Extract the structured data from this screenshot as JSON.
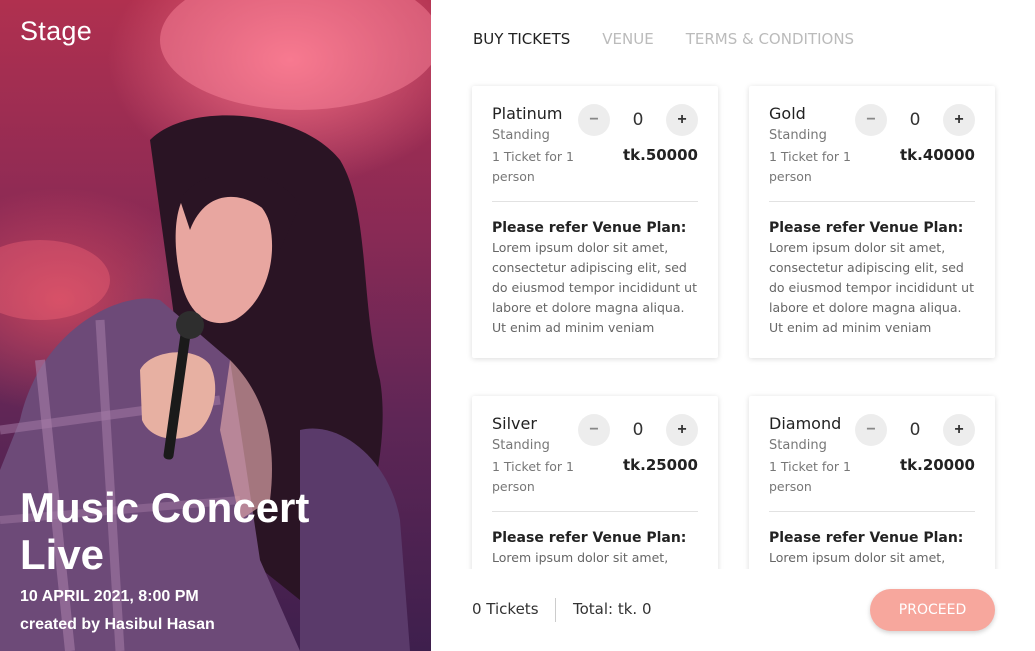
{
  "hero": {
    "brand": "Stage",
    "title": "Music Concert Live",
    "date": "10 APRIL 2021, 8:00 PM",
    "creator": "created by Hasibul Hasan"
  },
  "tabs": [
    {
      "label": "BUY TICKETS",
      "active": true
    },
    {
      "label": "VENUE",
      "active": false
    },
    {
      "label": "TERMS & CONDITIONS",
      "active": false
    }
  ],
  "tickets": [
    {
      "name": "Platinum",
      "type": "Standing",
      "desc": "1 Ticket for 1 person",
      "qty": "0",
      "price": "tk.50000",
      "minus": "−",
      "plus": "+",
      "plan_title": "Please refer Venue Plan:",
      "plan_text": "Lorem ipsum dolor sit amet, consectetur adipiscing elit, sed do eiusmod tempor incididunt ut labore et dolore magna aliqua. Ut enim ad minim veniam"
    },
    {
      "name": "Gold",
      "type": "Standing",
      "desc": "1 Ticket for 1 person",
      "qty": "0",
      "price": "tk.40000",
      "minus": "−",
      "plus": "+",
      "plan_title": "Please refer Venue Plan:",
      "plan_text": "Lorem ipsum dolor sit amet, consectetur adipiscing elit, sed do eiusmod tempor incididunt ut labore et dolore magna aliqua. Ut enim ad minim veniam"
    },
    {
      "name": "Silver",
      "type": "Standing",
      "desc": "1 Ticket for 1 person",
      "qty": "0",
      "price": "tk.25000",
      "minus": "−",
      "plus": "+",
      "plan_title": "Please refer Venue Plan:",
      "plan_text": "Lorem ipsum dolor sit amet,"
    },
    {
      "name": "Diamond",
      "type": "Standing",
      "desc": "1 Ticket for 1 person",
      "qty": "0",
      "price": "tk.20000",
      "minus": "−",
      "plus": "+",
      "plan_title": "Please refer Venue Plan:",
      "plan_text": "Lorem ipsum dolor sit amet,"
    }
  ],
  "footer": {
    "count": "0 Tickets",
    "total": "Total: tk. 0",
    "proceed": "PROCEED"
  },
  "colors": {
    "accent": "#f7a79d",
    "hero_top": "#b0304f",
    "hero_bottom": "#3e1f4d"
  }
}
